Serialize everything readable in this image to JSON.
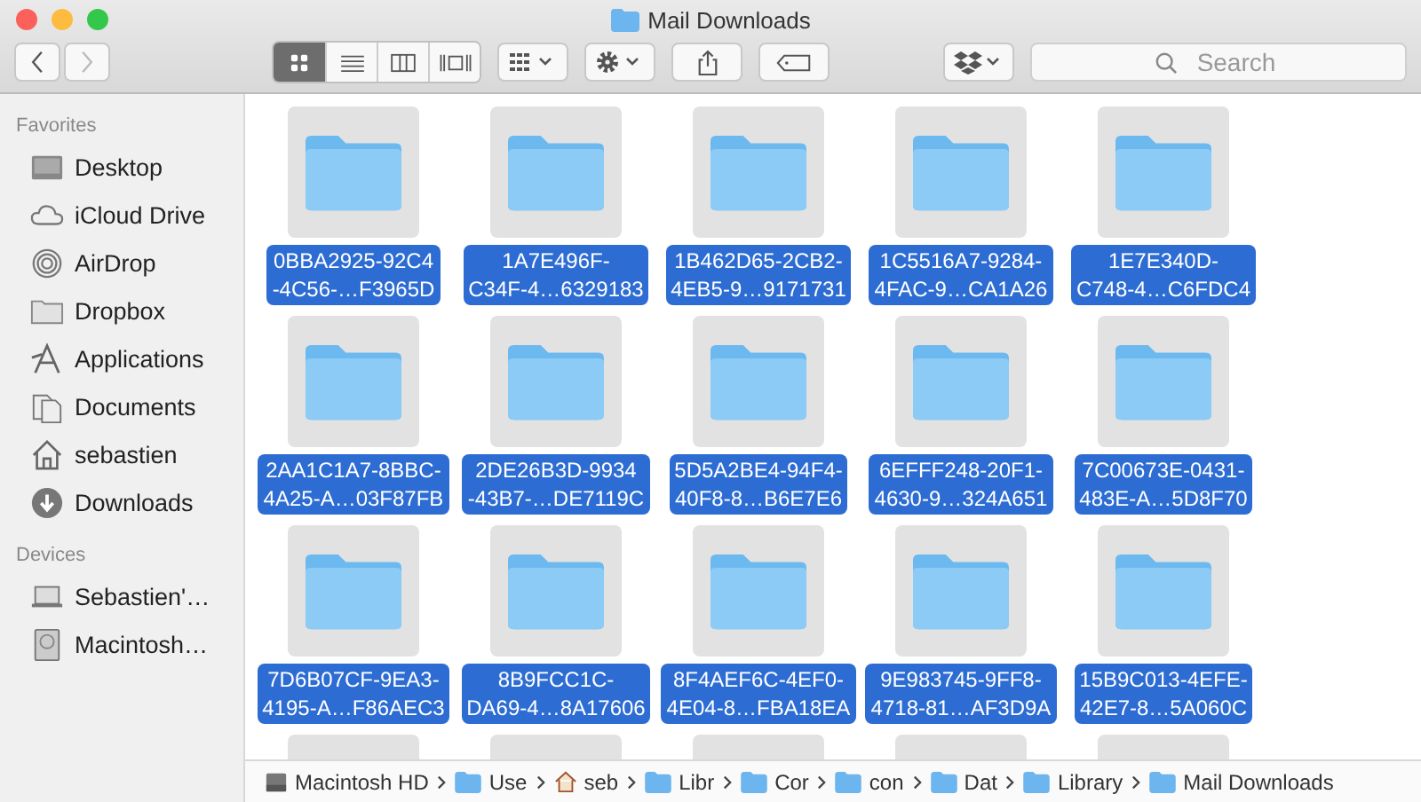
{
  "window": {
    "title": "Mail Downloads"
  },
  "toolbar": {
    "view_modes": [
      {
        "selected": true
      },
      {
        "selected": false
      },
      {
        "selected": false
      },
      {
        "selected": false
      }
    ],
    "search": {
      "placeholder": "Search"
    }
  },
  "sidebar": {
    "sections": [
      {
        "title": "Favorites",
        "items": [
          {
            "label": "Desktop"
          },
          {
            "label": "iCloud Drive"
          },
          {
            "label": "AirDrop"
          },
          {
            "label": "Dropbox"
          },
          {
            "label": "Applications"
          },
          {
            "label": "Documents"
          },
          {
            "label": "sebastien"
          },
          {
            "label": "Downloads"
          }
        ]
      },
      {
        "title": "Devices",
        "items": [
          {
            "label": "Sebastien'…"
          },
          {
            "label": "Macintosh…"
          }
        ]
      }
    ]
  },
  "files": [
    {
      "line1": "0BBA2925-92C4",
      "line2": "-4C56-…F3965D",
      "selected": true
    },
    {
      "line1": "1A7E496F-",
      "line2": "C34F-4…6329183",
      "selected": true
    },
    {
      "line1": "1B462D65-2CB2-",
      "line2": "4EB5-9…9171731",
      "selected": true
    },
    {
      "line1": "1C5516A7-9284-",
      "line2": "4FAC-9…CA1A26",
      "selected": true
    },
    {
      "line1": "1E7E340D-",
      "line2": "C748-4…C6FDC4",
      "selected": true
    },
    {
      "line1": "2AA1C1A7-8BBC-",
      "line2": "4A25-A…03F87FB",
      "selected": true
    },
    {
      "line1": "2DE26B3D-9934",
      "line2": "-43B7-…DE7119C",
      "selected": true
    },
    {
      "line1": "5D5A2BE4-94F4-",
      "line2": "40F8-8…B6E7E6",
      "selected": true
    },
    {
      "line1": "6EFFF248-20F1-",
      "line2": "4630-9…324A651",
      "selected": true
    },
    {
      "line1": "7C00673E-0431-",
      "line2": "483E-A…5D8F70",
      "selected": true
    },
    {
      "line1": "7D6B07CF-9EA3-",
      "line2": "4195-A…F86AEC3",
      "selected": true
    },
    {
      "line1": "8B9FCC1C-",
      "line2": "DA69-4…8A17606",
      "selected": true
    },
    {
      "line1": "8F4AEF6C-4EF0-",
      "line2": "4E04-8…FBA18EA",
      "selected": true
    },
    {
      "line1": "9E983745-9FF8-",
      "line2": "4718-81…AF3D9A",
      "selected": true
    },
    {
      "line1": "15B9C013-4EFE-",
      "line2": "42E7-8…5A060C",
      "selected": true
    }
  ],
  "path_bar": [
    {
      "label": "Macintosh HD",
      "kind": "disk"
    },
    {
      "label": "Use",
      "kind": "folder"
    },
    {
      "label": "seb",
      "kind": "home"
    },
    {
      "label": "Libr",
      "kind": "folder"
    },
    {
      "label": "Cor",
      "kind": "folder"
    },
    {
      "label": "con",
      "kind": "folder"
    },
    {
      "label": "Dat",
      "kind": "folder"
    },
    {
      "label": "Library",
      "kind": "folder"
    },
    {
      "label": "Mail Downloads",
      "kind": "folder"
    }
  ]
}
